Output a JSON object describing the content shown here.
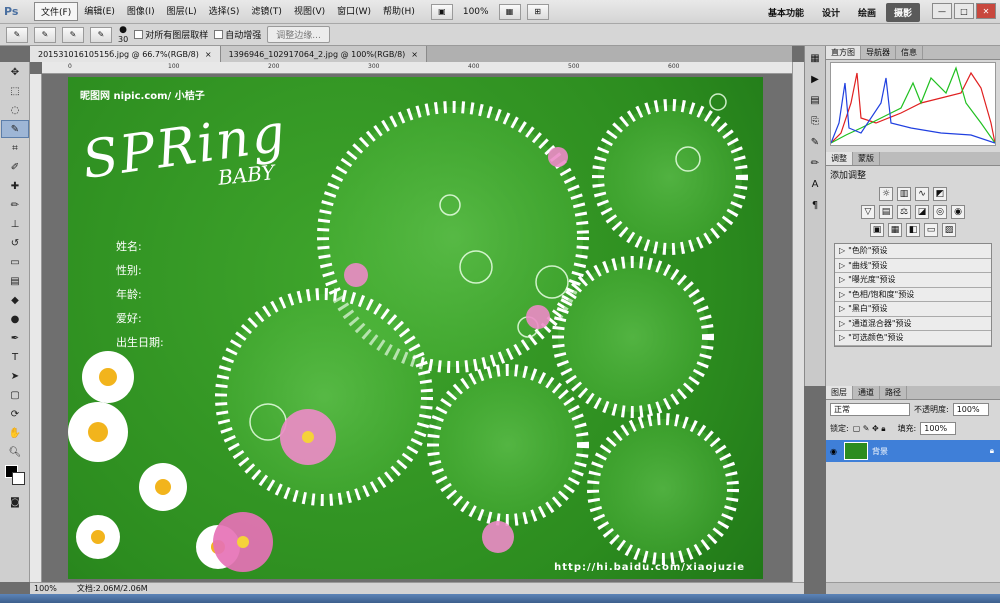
{
  "app": {
    "logo": "Ps",
    "menu": [
      "文件(F)",
      "编辑(E)",
      "图像(I)",
      "图层(L)",
      "选择(S)",
      "滤镜(T)",
      "视图(V)",
      "窗口(W)",
      "帮助(H)"
    ],
    "zoom": "100%",
    "workspaces": [
      "基本功能",
      "设计",
      "绘画",
      "摄影"
    ],
    "window_controls": [
      "—",
      "□",
      "✕"
    ]
  },
  "options": {
    "brush_size": "30",
    "sample_all_layers": "对所有图层取样",
    "auto_enhance": "自动增强",
    "refine_edge": "调整边缘..."
  },
  "tabs": [
    {
      "label": "20153101610515б.jpg @ 66.7%(RGB/8)"
    },
    {
      "label": "1396946_102917064_2.jpg @ 100%(RGB/8)"
    }
  ],
  "artwork": {
    "credit": "昵图网 nipic.com/ 小桔子",
    "title": "SPRing",
    "subtitle": "BABY",
    "fields": [
      "姓名:",
      "性别:",
      "年龄:",
      "爱好:",
      "出生日期:"
    ],
    "url": "http://hi.baidu.com/xiaojuzie"
  },
  "status": {
    "zoom": "100%",
    "doc": "文档:2.06M/2.06M"
  },
  "panels": {
    "histogram_tabs": [
      "直方图",
      "导航器",
      "信息"
    ],
    "adjust_tabs": [
      "调整",
      "蒙版"
    ],
    "adjust_title": "添加调整",
    "presets": [
      "\"色阶\"预设",
      "\"曲线\"预设",
      "\"曝光度\"预设",
      "\"色相/饱和度\"预设",
      "\"黑白\"预设",
      "\"通道混合器\"预设",
      "\"可选颜色\"预设"
    ],
    "layers_tabs": [
      "图层",
      "通道",
      "路径"
    ],
    "blend_mode": "正常",
    "opacity_label": "不透明度:",
    "opacity": "100%",
    "lock_label": "锁定:",
    "fill_label": "填充:",
    "fill": "100%",
    "layer_name": "背景"
  },
  "colors": {
    "artboard": "#2c8c1f",
    "layer_selected": "#3f7fd8",
    "histogram_red": "#e02020",
    "histogram_green": "#20c020",
    "histogram_blue": "#2040e0"
  }
}
